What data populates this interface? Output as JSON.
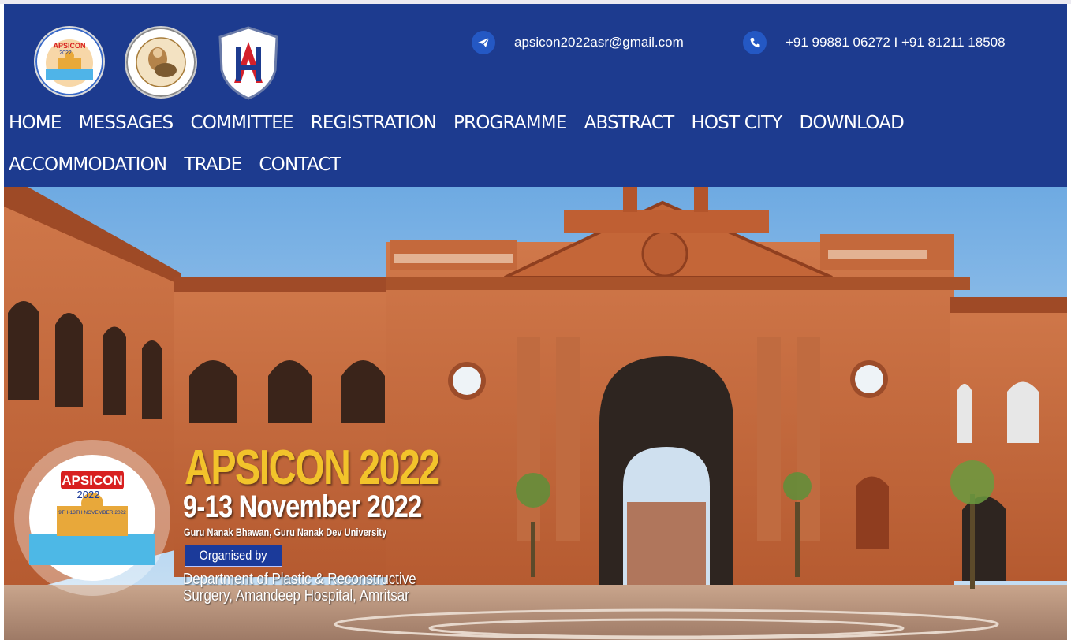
{
  "header": {
    "email": "apsicon2022asr@gmail.com",
    "phone": "+91 99881 06272 I +91 81211 18508",
    "logos": {
      "logo1_text": "APSICON",
      "logo1_year": "2022"
    }
  },
  "nav": {
    "items": [
      "HOME",
      "MESSAGES",
      "COMMITTEE",
      "REGISTRATION",
      "PROGRAMME",
      "ABSTRACT",
      "HOST CITY",
      "DOWNLOAD",
      "ACCOMMODATION",
      "TRADE",
      "CONTACT"
    ]
  },
  "hero": {
    "title": "APSICON 2022",
    "dates": "9-13 November 2022",
    "venue": "Guru Nanak Bhawan, Guru Nanak Dev University",
    "organised_label": "Organised by",
    "dept_line1": "Department of Plastic & Reconstructive",
    "dept_line2": "Surgery, Amandeep Hospital, Amritsar",
    "badge": {
      "name": "APSICON",
      "year": "2022",
      "dates": "9TH-13TH NOVEMBER 2022"
    }
  },
  "colors": {
    "header_bg": "#1d3b8f",
    "title_gold": "#f2c32b",
    "icon_blue": "#2458c4"
  }
}
